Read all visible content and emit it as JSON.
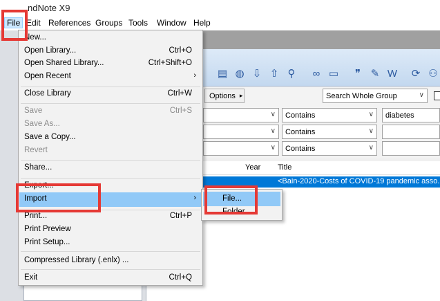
{
  "window": {
    "title": "ndNote X9"
  },
  "menubar": [
    {
      "label": "File",
      "active": true
    },
    {
      "label": "Edit"
    },
    {
      "label": "References"
    },
    {
      "label": "Groups"
    },
    {
      "label": "Tools"
    },
    {
      "label": "Window"
    },
    {
      "label": "Help"
    }
  ],
  "file_menu": {
    "new": "New...",
    "open_library": {
      "label": "Open Library...",
      "shortcut": "Ctrl+O"
    },
    "open_shared": {
      "label": "Open Shared Library...",
      "shortcut": "Ctrl+Shift+O"
    },
    "open_recent": "Open Recent",
    "close_library": {
      "label": "Close Library",
      "shortcut": "Ctrl+W"
    },
    "save": {
      "label": "Save",
      "shortcut": "Ctrl+S"
    },
    "save_as": "Save As...",
    "save_copy": "Save a Copy...",
    "revert": "Revert",
    "share": "Share...",
    "export": "Export...",
    "import": "Import",
    "print": {
      "label": "Print...",
      "shortcut": "Ctrl+P"
    },
    "print_preview": "Print Preview",
    "print_setup": "Print Setup...",
    "compressed": "Compressed Library (.enlx) ...",
    "exit": {
      "label": "Exit",
      "shortcut": "Ctrl+Q"
    },
    "submenu_arrow": "›"
  },
  "import_submenu": {
    "file": "File...",
    "folder": "Folder..."
  },
  "search": {
    "options_label": "Options",
    "options_arrow": "▸",
    "scope": "Search Whole Group",
    "dropdown_arrow": "∨",
    "rows": [
      {
        "op": "Contains",
        "value": "diabetes"
      },
      {
        "op": "Contains",
        "value": ""
      },
      {
        "op": "Contains",
        "value": ""
      }
    ]
  },
  "list": {
    "col_year": "Year",
    "col_title": "Title",
    "selected_row_title": "<Bain-2020-Costs of COVID-19 pandemic asso..."
  },
  "toolbar_icons": [
    "insert-citation-icon",
    "online-search-icon",
    "import-icon",
    "export-icon",
    "find-fulltext-icon",
    "link-icon",
    "folder-icon",
    "quote-icon",
    "edit-icon",
    "word-icon",
    "sync-icon",
    "share-user-icon"
  ],
  "colors": {
    "accent": "#0078d7",
    "menu_highlight": "#91c9f7",
    "annotation": "#e53935"
  }
}
